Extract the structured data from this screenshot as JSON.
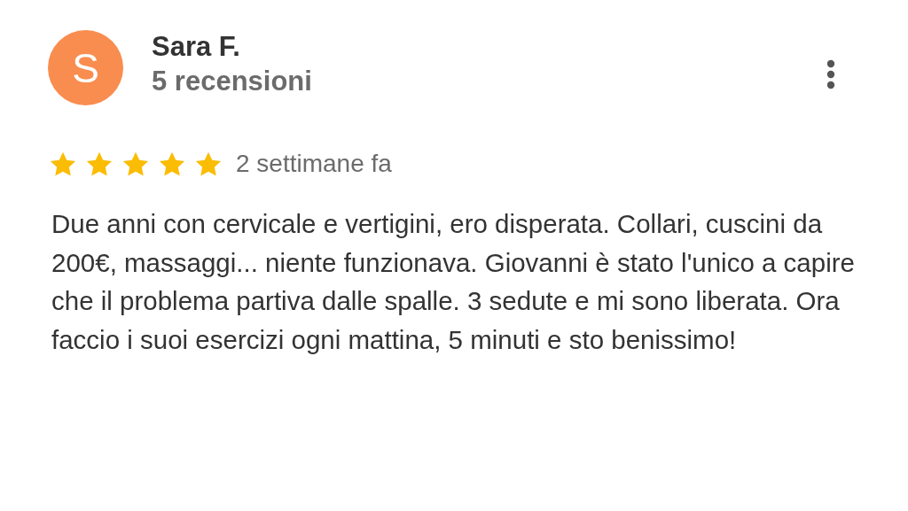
{
  "review": {
    "avatar_letter": "S",
    "author": "Sara F.",
    "review_count": "5 recensioni",
    "stars": 5,
    "time": "2 settimane fa",
    "text": "Due anni con cervicale e vertigini, ero disperata. Collari, cuscini da 200€, massaggi... niente funzionava. Giovanni è stato l'unico a capire che il problema partiva dalle spalle. 3 sedute e mi sono liberata. Ora faccio i suoi esercizi ogni mattina, 5 minuti e sto benissimo!"
  }
}
